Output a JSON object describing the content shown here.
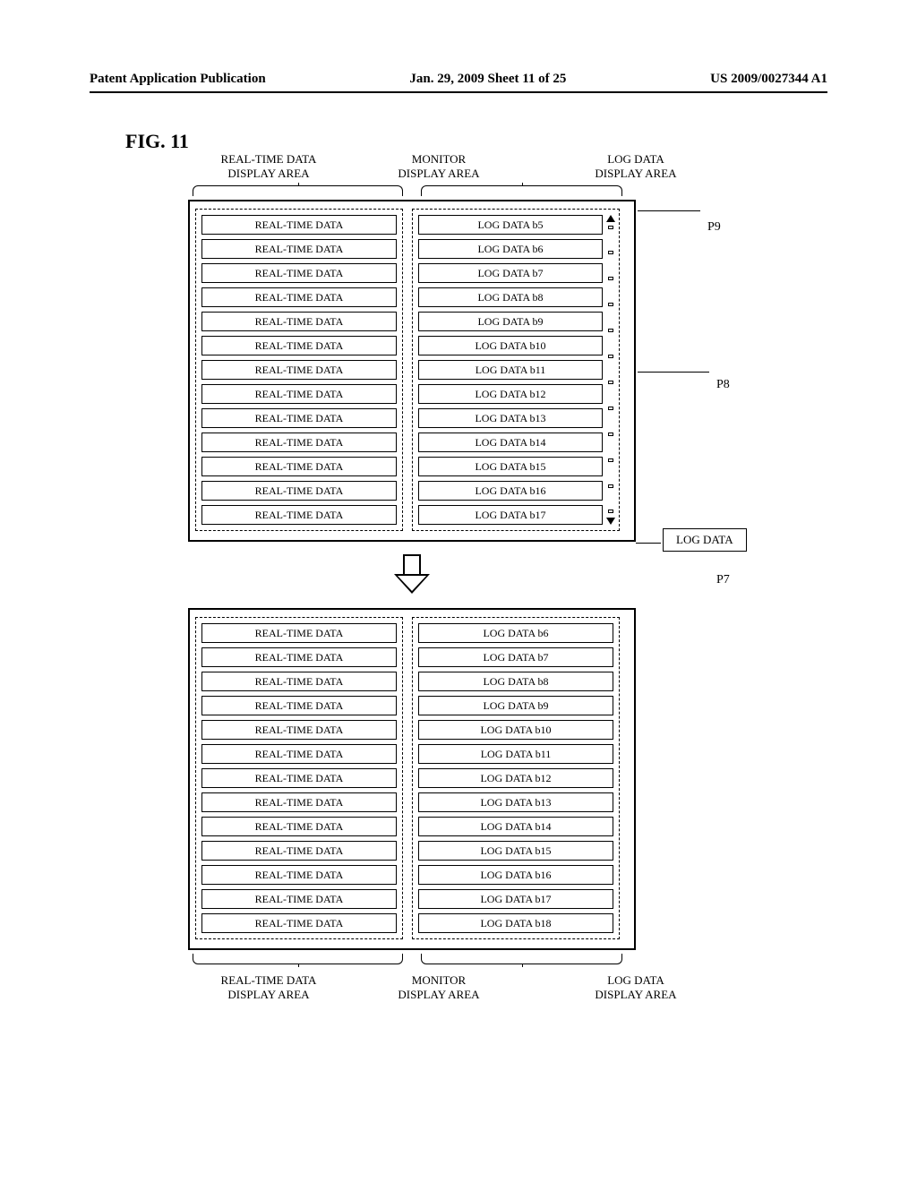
{
  "header": {
    "left": "Patent Application Publication",
    "center": "Jan. 29, 2009  Sheet 11 of 25",
    "right": "US 2009/0027344 A1"
  },
  "figure_label": "FIG. 11",
  "labels": {
    "realtime": "REAL-TIME DATA\nDISPLAY AREA",
    "monitor": "MONITOR\nDISPLAY AREA",
    "log": "LOG DATA\nDISPLAY AREA"
  },
  "panel_top": {
    "realtime_rows": [
      "REAL-TIME DATA",
      "REAL-TIME DATA",
      "REAL-TIME DATA",
      "REAL-TIME DATA",
      "REAL-TIME DATA",
      "REAL-TIME DATA",
      "REAL-TIME DATA",
      "REAL-TIME DATA",
      "REAL-TIME DATA",
      "REAL-TIME DATA",
      "REAL-TIME DATA",
      "REAL-TIME DATA",
      "REAL-TIME DATA"
    ],
    "log_rows": [
      "LOG DATA b5",
      "LOG DATA b6",
      "LOG DATA b7",
      "LOG DATA b8",
      "LOG DATA b9",
      "LOG DATA b10",
      "LOG DATA b11",
      "LOG DATA b12",
      "LOG DATA b13",
      "LOG DATA b14",
      "LOG DATA b15",
      "LOG DATA b16",
      "LOG DATA b17"
    ]
  },
  "panel_bottom": {
    "realtime_rows": [
      "REAL-TIME DATA",
      "REAL-TIME DATA",
      "REAL-TIME DATA",
      "REAL-TIME DATA",
      "REAL-TIME DATA",
      "REAL-TIME DATA",
      "REAL-TIME DATA",
      "REAL-TIME DATA",
      "REAL-TIME DATA",
      "REAL-TIME DATA",
      "REAL-TIME DATA",
      "REAL-TIME DATA",
      "REAL-TIME DATA"
    ],
    "log_rows": [
      "LOG DATA b6",
      "LOG DATA b7",
      "LOG DATA b8",
      "LOG DATA b9",
      "LOG DATA b10",
      "LOG DATA b11",
      "LOG DATA b12",
      "LOG DATA b13",
      "LOG DATA b14",
      "LOG DATA b15",
      "LOG DATA b16",
      "LOG DATA b17",
      "LOG DATA b18"
    ]
  },
  "callouts": {
    "p9": "P9",
    "p8": "P8",
    "p7": "P7",
    "p7_box": "LOG DATA"
  }
}
